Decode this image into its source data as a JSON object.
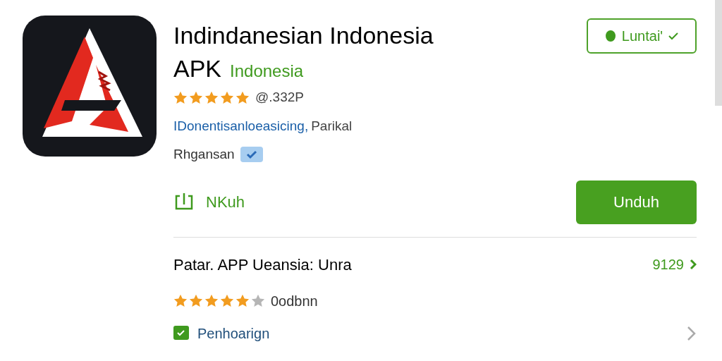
{
  "app": {
    "title": "Indindanesian Indonesia",
    "title_suffix": "APK",
    "region": "Indonesia",
    "stars": 5,
    "rating": "@.332P",
    "developer": "IDonentisanloeasicing,",
    "category": "Parikal",
    "tag": "Rhgansan",
    "verified": true
  },
  "status_button": {
    "label": "Luntai'",
    "checked": true
  },
  "share": {
    "label": "NKuh"
  },
  "download": {
    "label": "Unduh"
  },
  "related": {
    "title": "Patar. APP Ueansia: Unra",
    "count": "9129",
    "stars": 5,
    "reviews": "0odbnn",
    "link": "Penhoarign"
  }
}
